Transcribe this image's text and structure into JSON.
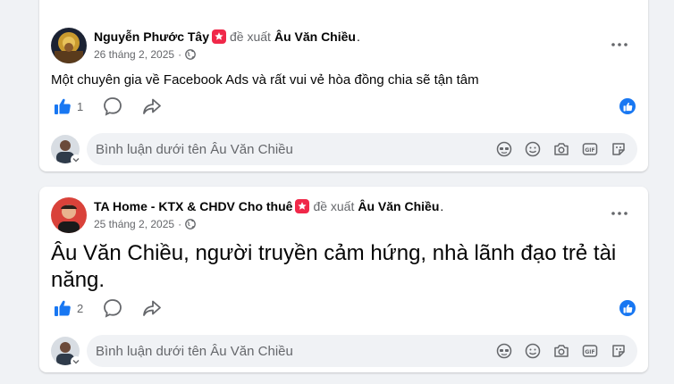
{
  "posts": [
    {
      "author": "Nguyễn Phước Tây",
      "verb": "đề xuất",
      "page": "Âu Văn Chiều",
      "date": "26 tháng 2, 2025",
      "separator": "·",
      "text": "Một chuyên gia về Facebook Ads và rất vui vẻ hòa đồng chia sẽ tận tâm",
      "like_count": "1",
      "comment_placeholder": "Bình luận dưới tên Âu Văn Chiều"
    },
    {
      "author": "TA Home - KTX & CHDV Cho thuê",
      "verb": "đề xuất",
      "page": "Âu Văn Chiều",
      "date": "25 tháng 2, 2025",
      "separator": "·",
      "text": "Âu Văn Chiều, người truyền cảm hứng, nhà lãnh đạo trẻ tài năng.",
      "like_count": "2",
      "comment_placeholder": "Bình luận dưới tên Âu Văn Chiều"
    }
  ],
  "punct": ".",
  "icons": {
    "recommend": "recommend-badge-icon",
    "privacy": "globe-icon",
    "more": "more-options-icon",
    "like": "like-thumb-icon",
    "comment": "comment-bubble-icon",
    "share": "share-arrow-icon",
    "liked": "liked-badge-icon",
    "avatar_sticker": "avatar-sticker-icon",
    "emoji": "emoji-icon",
    "camera": "camera-icon",
    "gif": "gif-icon",
    "sticker": "sticker-icon"
  },
  "colors": {
    "accent": "#1877f2",
    "recommend": "#f02849",
    "muted": "#65676b",
    "background": "#f0f2f5"
  }
}
